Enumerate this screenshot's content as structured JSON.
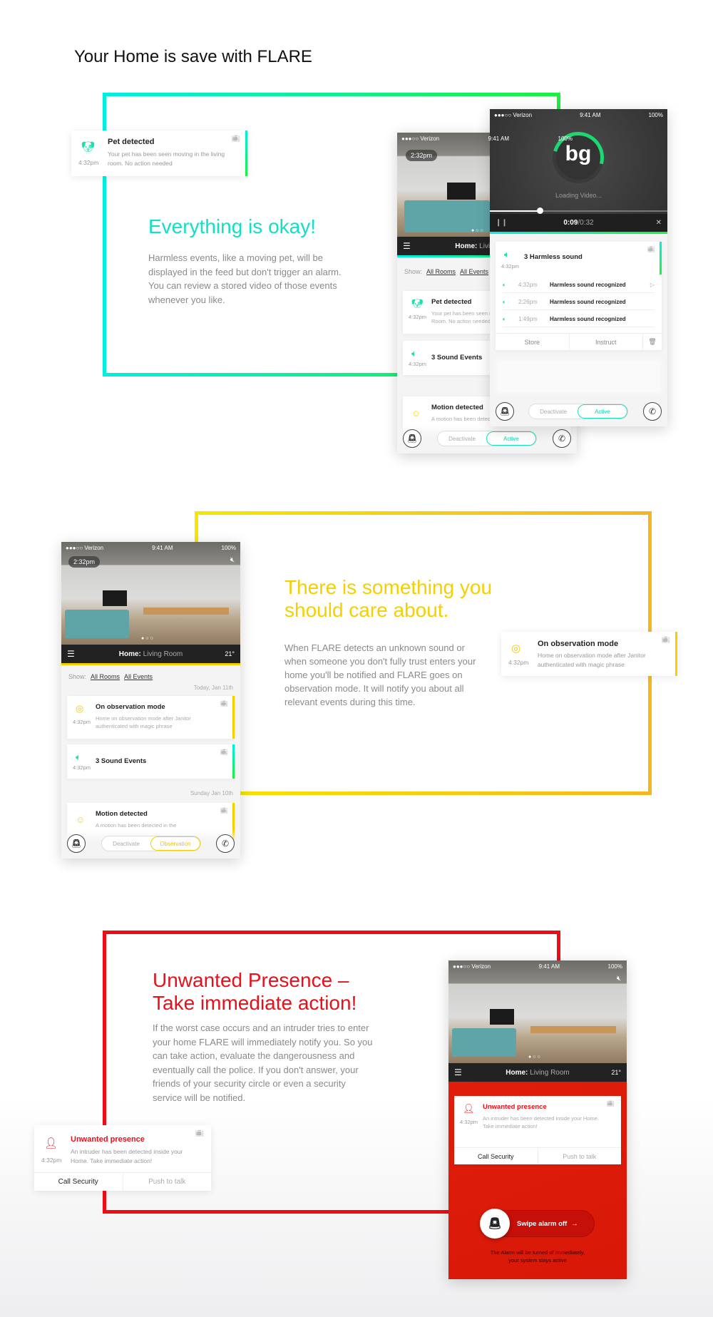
{
  "page_title": "Your Home is save with FLARE",
  "colors": {
    "ok": "#00e8d8",
    "ok2": "#1ce84a",
    "care": "#f5d800",
    "care2": "#f3b81c",
    "alarm": "#e8101a"
  },
  "status_bar": {
    "carrier": "●●●○○ Verizon",
    "time": "9:41 AM",
    "battery": "100%"
  },
  "section_ok": {
    "heading": "Everything is okay!",
    "body": "Harmless events, like a moving pet, will be displayed in the feed but don't trigger an alarm. You can review a stored video of those events whenever you like.",
    "notification": {
      "title": "Pet detected",
      "desc": "Your pet has been seen moving in the living room. No action needed",
      "time": "4:32pm",
      "icon": "dog-icon"
    },
    "feed_phone": {
      "photo_time": "2:32pm",
      "nav_home": "Home:",
      "nav_room": "Living Room",
      "show_label": "Show:",
      "filter_rooms": "All Rooms",
      "filter_events": "All Events",
      "events": [
        {
          "title": "Pet detected",
          "desc": "Your pet has been seen moving in the living Room. No action needed",
          "time": "4:32pm",
          "icon": "dog-icon"
        },
        {
          "title": "3 Sound Events",
          "desc": "",
          "time": "4:32pm",
          "icon": "speaker-icon"
        },
        {
          "title": "Motion detected",
          "desc": "A motion has been detected in the",
          "time": "",
          "icon": "motion-icon"
        }
      ],
      "deactivate": "Deactivate",
      "mode": "Active"
    },
    "video_phone": {
      "logo": "bg",
      "loading": "Loading Video...",
      "elapsed": "0:09",
      "duration": "/0:32",
      "progress": 0.28,
      "expanded": {
        "title": "3 Harmless sound",
        "time": "4:32pm",
        "rows": [
          {
            "time": "4:32pm",
            "label": "Harmless sound recognized"
          },
          {
            "time": "2:26pm",
            "label": "Harmless sound recognized"
          },
          {
            "time": "1:49pm",
            "label": "Harmless sound recognized"
          }
        ],
        "store": "Store",
        "instruct": "Instruct"
      },
      "deactivate": "Deactivate",
      "mode": "Active"
    }
  },
  "section_care": {
    "heading_1": "There is something you",
    "heading_2": "should care about.",
    "body": "When FLARE detects an unknown sound or when someone you don't fully trust enters your home you'll be notified and FLARE goes on observation mode. It will notify you about all relevant events during this time.",
    "notification": {
      "title": "On observation mode",
      "desc": "Home on observation mode after Janitor authenticated with magic phrase",
      "time": "4:32pm",
      "icon": "eye-icon"
    },
    "phone": {
      "photo_time": "2:32pm",
      "nav_home": "Home:",
      "nav_room": "Living Room",
      "temp": "21°",
      "show_label": "Show:",
      "filter_rooms": "All Rooms",
      "filter_events": "All Events",
      "date_today": "Today, Jan 11th",
      "date_prev": "Sunday Jan 10th",
      "events": [
        {
          "title": "On observation mode",
          "desc": "Home on observation mode after Janitor authenticated with magic phrase",
          "time": "4:32pm"
        },
        {
          "title": "3 Sound Events",
          "time": "4:32pm"
        },
        {
          "title": "Motion detected",
          "desc": "A motion has been detected in the"
        }
      ],
      "deactivate": "Deactivate",
      "mode": "Observation"
    }
  },
  "section_alarm": {
    "heading_1": "Unwanted Presence –",
    "heading_2": "Take immediate action!",
    "body": "If the worst case occurs and an intruder tries to enter your home FLARE will immediately notify you. So you can take action, evaluate the dangerousness and eventually call the police. If you don't answer, your friends of your security circle or even a security service will be notified.",
    "notification": {
      "title": "Unwanted presence",
      "desc": "An intruder has been detected inside your Home. Take immediate action!",
      "time": "4:32pm",
      "call": "Call Security",
      "talk": "Push to talk"
    },
    "phone": {
      "nav_home": "Home:",
      "nav_room": "Living Room",
      "temp": "21°",
      "card": {
        "title": "Unwanted presence",
        "desc": "An intruder has been detected inside your Home. Take immediate action!",
        "time": "4:32pm",
        "call": "Call Security",
        "talk": "Push to talk"
      },
      "swipe": "Swipe alarm off",
      "note_1": "The Alarm will be turned of immediately,",
      "note_2": "your system stays active"
    }
  }
}
